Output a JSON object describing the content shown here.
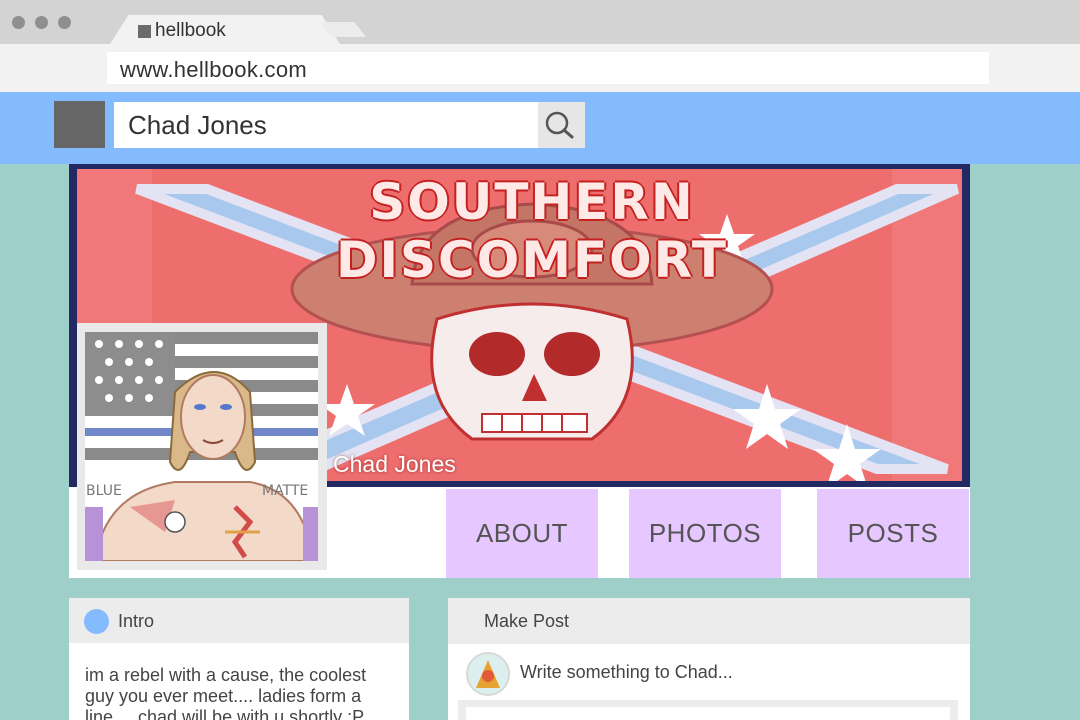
{
  "browser": {
    "tab_title": "hellbook",
    "url": "www.hellbook.com"
  },
  "header": {
    "search_value": "Chad Jones",
    "search_icon": "search-icon"
  },
  "profile": {
    "cover_title": "SOUTHERN DISCOMFORT",
    "name": "Chad Jones",
    "avatar_caption_left": "BLUE",
    "avatar_caption_right": "MATTE"
  },
  "nav": {
    "tabs": [
      "ABOUT",
      "PHOTOS",
      "POSTS"
    ]
  },
  "intro": {
    "title": "Intro",
    "text": "im a rebel with a cause, the coolest guy you ever meet.... ladies form a line.... chad will be with u shortly ;P"
  },
  "make_post": {
    "title": "Make Post",
    "prompt": "Write something to Chad..."
  },
  "colors": {
    "page_bg": "#9fcfc9",
    "header_blue": "#84bbff",
    "tab_lavender": "#e6c7ff",
    "cover_border": "#232a63",
    "cover_red": "#f07878"
  }
}
